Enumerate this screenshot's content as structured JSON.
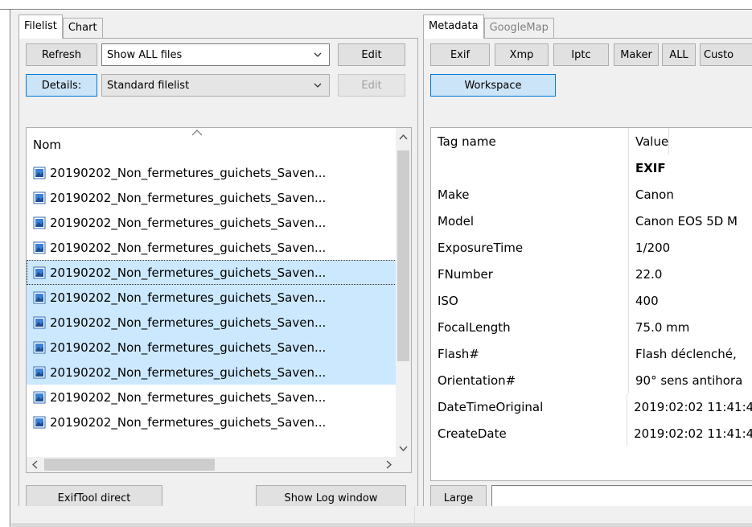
{
  "left_panel": {
    "tabs": [
      {
        "label": "Filelist",
        "active": true
      },
      {
        "label": "Chart",
        "active": false
      }
    ],
    "refresh_label": "Refresh",
    "filter_value": "Show ALL files",
    "edit_label": "Edit",
    "details_label": "Details:",
    "filelist_mode_value": "Standard filelist",
    "edit2_label": "Edit",
    "column_header": "Nom",
    "files": [
      "20190202_Non_fermetures_guichets_Saven...",
      "20190202_Non_fermetures_guichets_Saven...",
      "20190202_Non_fermetures_guichets_Saven...",
      "20190202_Non_fermetures_guichets_Saven...",
      "20190202_Non_fermetures_guichets_Saven...",
      "20190202_Non_fermetures_guichets_Saven...",
      "20190202_Non_fermetures_guichets_Saven...",
      "20190202_Non_fermetures_guichets_Saven...",
      "20190202_Non_fermetures_guichets_Saven...",
      "20190202_Non_fermetures_guichets_Saven...",
      "20190202_Non_fermetures_guichets_Saven..."
    ],
    "exiftool_direct_label": "ExifTool direct",
    "show_log_label": "Show Log window"
  },
  "right_panel": {
    "tabs": [
      {
        "label": "Metadata",
        "active": true
      },
      {
        "label": "GoogleMap",
        "active": false
      }
    ],
    "buttons": [
      "Exif",
      "Xmp",
      "Iptc",
      "Maker",
      "ALL",
      "Custo"
    ],
    "workspace_label": "Workspace",
    "header": {
      "tag": "Tag name",
      "value": "Value"
    },
    "section": "EXIF",
    "rows": [
      {
        "tag": "Make",
        "value": "Canon"
      },
      {
        "tag": "Model",
        "value": "Canon EOS 5D M"
      },
      {
        "tag": "ExposureTime",
        "value": "1/200"
      },
      {
        "tag": "FNumber",
        "value": "22.0"
      },
      {
        "tag": "ISO",
        "value": "400"
      },
      {
        "tag": "FocalLength",
        "value": "75.0 mm"
      },
      {
        "tag": "Flash#",
        "value": "Flash déclenché,"
      },
      {
        "tag": "Orientation#",
        "value": "90° sens antihora"
      },
      {
        "tag": "DateTimeOriginal",
        "value": "2019:02:02 11:41:4"
      },
      {
        "tag": "CreateDate",
        "value": "2019:02:02 11:41:4"
      }
    ],
    "large_label": "Large"
  },
  "colors": {
    "selection": "#cce8ff",
    "accent_button": "#cce4f7",
    "accent_border": "#0078d7"
  }
}
